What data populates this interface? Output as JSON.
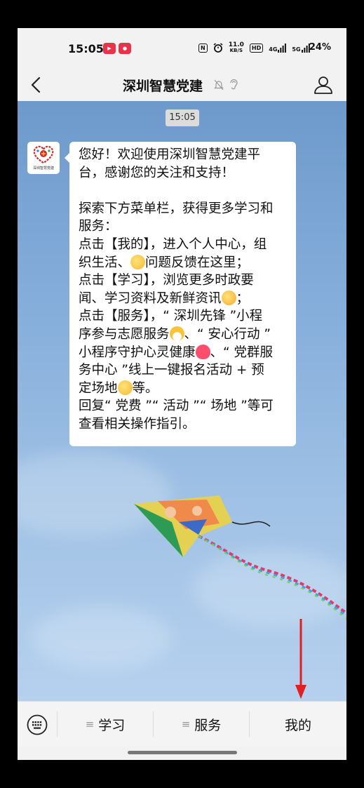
{
  "status_bar": {
    "time": "15:05",
    "app_badges": [
      "video-app-badge",
      "news-app-badge"
    ],
    "nfc": "N",
    "speed_value": "11.0",
    "speed_unit": "KB/S",
    "hd": "HD",
    "network_a": "4G",
    "network_b": "5G",
    "battery": "24%"
  },
  "nav": {
    "title": "深圳智慧党建"
  },
  "chat": {
    "time_chip": "15:05",
    "avatar_caption": "深圳智慧党建",
    "message_lines": [
      "您好！欢迎使用深圳智慧党建平",
      "台，感谢您的关注和支持！",
      "",
      "探索下方菜单栏，获得更多学习和",
      "服务：",
      "点击【我的】，进入个人中心，组",
      "织生活、",
      "问题反馈在这里；",
      "点击【学习】，浏览更多时政要",
      "闻、学习资料及新鲜资讯",
      "；",
      "点击【服务】，“ 深圳先锋 ”小程",
      "序参与志愿服务",
      "、“ 安心行动 ”",
      "小程序守护心灵健康",
      "、“ 党群服",
      "务中心 ”线上一键报名活动 + 预",
      "定场地",
      "等。",
      "回复“ 党费 ”“ 活动 ”“ 场地 ”等可",
      "查看相关操作指引。"
    ],
    "emojis": [
      "thinking-face",
      "wow-face",
      "mask-face",
      "pink-heart",
      "monocle-face"
    ]
  },
  "bottom_menu": {
    "items": [
      "学习",
      "服务",
      "我的"
    ]
  },
  "colors": {
    "sky_top": "#6d9acb",
    "sky_bottom": "#b6d1ee",
    "arrow": "#e02020",
    "heart": "#ff4d6d"
  }
}
